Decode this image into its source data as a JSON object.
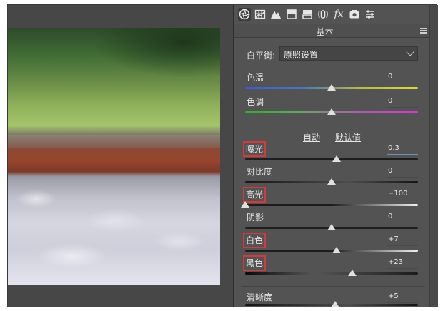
{
  "panel": {
    "section_title": "基本",
    "toolbar_icons": [
      "aperture-icon",
      "histogram-grid-icon",
      "tone-curve-icon",
      "detail-icon",
      "split-toning-icon",
      "lens-correction-icon",
      "fx-icon",
      "camera-calibration-icon",
      "presets-icon"
    ],
    "fx_label": "fx",
    "white_balance": {
      "label": "白平衡:",
      "value": "原照设置"
    },
    "sliders_wb": [
      {
        "label": "色温",
        "value": "0",
        "fraction": 0.5
      },
      {
        "label": "色调",
        "value": "0",
        "fraction": 0.5
      }
    ],
    "auto_label": "自动",
    "default_label": "默认值",
    "sliders_tone": [
      {
        "label": "曝光",
        "value": "0.3",
        "fraction": 0.53,
        "highlighted": true
      },
      {
        "label": "对比度",
        "value": "0",
        "fraction": 0.5,
        "highlighted": false
      },
      {
        "label": "高光",
        "value": "−100",
        "fraction": 0.0,
        "highlighted": true
      },
      {
        "label": "阴影",
        "value": "0",
        "fraction": 0.5,
        "highlighted": false
      },
      {
        "label": "白色",
        "value": "+7",
        "fraction": 0.53,
        "highlighted": true
      },
      {
        "label": "黑色",
        "value": "+23",
        "fraction": 0.62,
        "highlighted": true
      }
    ],
    "sliders_presence": [
      {
        "label": "清晰度",
        "value": "+5",
        "fraction": 0.52
      }
    ]
  },
  "colors": {
    "highlight_box": "#d43a3a",
    "panel_bg": "#535353"
  }
}
